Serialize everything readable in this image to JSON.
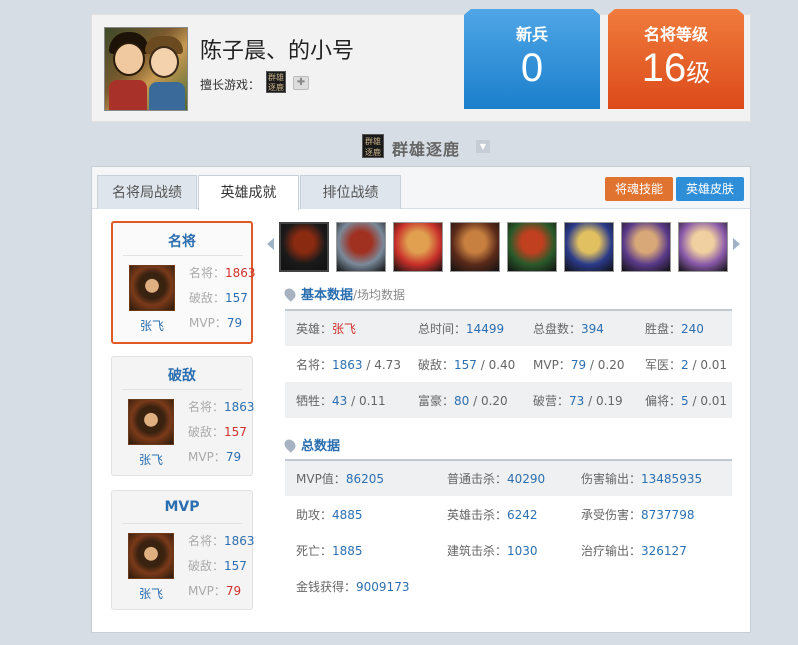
{
  "header": {
    "username": "陈子晨、的小号",
    "game_label": "擅长游戏：",
    "game_icon_text": "群雄逐鹿",
    "badges": [
      {
        "title": "新兵",
        "value": "0",
        "unit": "",
        "color": "#2b8ad9"
      },
      {
        "title": "名将等级",
        "value": "16",
        "unit": "级",
        "color": "#e35a22"
      }
    ]
  },
  "game_selector": {
    "icon_text": "群雄逐鹿",
    "name": "群雄逐鹿"
  },
  "tabs": [
    {
      "label": "名将局战绩",
      "active": false
    },
    {
      "label": "英雄成就",
      "active": true
    },
    {
      "label": "排位战绩",
      "active": false
    }
  ],
  "buttons": {
    "skill": "将魂技能",
    "skin": "英雄皮肤"
  },
  "cards": [
    {
      "title": "名将",
      "hero": "张飞",
      "stats": [
        {
          "label": "名将：",
          "value": "1863",
          "red": true
        },
        {
          "label": "破敌：",
          "value": "157",
          "red": false
        },
        {
          "label": "MVP：",
          "value": "79",
          "red": false
        }
      ]
    },
    {
      "title": "破敌",
      "hero": "张飞",
      "stats": [
        {
          "label": "名将：",
          "value": "1863",
          "red": false
        },
        {
          "label": "破敌：",
          "value": "157",
          "red": true
        },
        {
          "label": "MVP：",
          "value": "79",
          "red": false
        }
      ]
    },
    {
      "title": "MVP",
      "hero": "张飞",
      "stats": [
        {
          "label": "名将：",
          "value": "1863",
          "red": false
        },
        {
          "label": "破敌：",
          "value": "157",
          "red": false
        },
        {
          "label": "MVP：",
          "value": "79",
          "red": true
        }
      ]
    }
  ],
  "hero_strip": [
    {
      "name": "hero-portrait-1",
      "colors": [
        "#1a1a1a",
        "#8a2a10"
      ],
      "selected": true
    },
    {
      "name": "hero-portrait-2",
      "colors": [
        "#7a8a9a",
        "#a03020"
      ],
      "selected": false
    },
    {
      "name": "hero-portrait-3",
      "colors": [
        "#c8302a",
        "#e0a050"
      ],
      "selected": false
    },
    {
      "name": "hero-portrait-4",
      "colors": [
        "#5a2a1a",
        "#c88040"
      ],
      "selected": false
    },
    {
      "name": "hero-portrait-5",
      "colors": [
        "#2a5a2a",
        "#c04020"
      ],
      "selected": false
    },
    {
      "name": "hero-portrait-6",
      "colors": [
        "#2a3a8a",
        "#e0c060"
      ],
      "selected": false
    },
    {
      "name": "hero-portrait-7",
      "colors": [
        "#5a3a8a",
        "#d8a878"
      ],
      "selected": false
    },
    {
      "name": "hero-portrait-8",
      "colors": [
        "#8a5aaa",
        "#f0d0a0"
      ],
      "selected": false
    }
  ],
  "basic": {
    "title": "基本数据",
    "subtitle": "/场均数据",
    "rows": [
      [
        {
          "label": "英雄：",
          "value": "张飞",
          "red": true,
          "rest": ""
        },
        {
          "label": "总时间：",
          "value": "14499",
          "rest": ""
        },
        {
          "label": "总盘数：",
          "value": "394",
          "rest": ""
        },
        {
          "label": "胜盘：",
          "value": "240",
          "rest": ""
        }
      ],
      [
        {
          "label": "名将：",
          "value": "1863",
          "rest": " / 4.73"
        },
        {
          "label": "破敌：",
          "value": "157",
          "rest": " / 0.40"
        },
        {
          "label": "MVP：",
          "value": "79",
          "rest": " / 0.20"
        },
        {
          "label": "军医：",
          "value": "2",
          "rest": " / 0.01"
        }
      ],
      [
        {
          "label": "牺牲：",
          "value": "43",
          "rest": " / 0.11"
        },
        {
          "label": "富豪：",
          "value": "80",
          "rest": " / 0.20"
        },
        {
          "label": "破营：",
          "value": "73",
          "rest": " / 0.19"
        },
        {
          "label": "偏将：",
          "value": "5",
          "rest": " / 0.01"
        }
      ]
    ]
  },
  "totals": {
    "title": "总数据",
    "rows": [
      [
        {
          "label": "MVP值：",
          "value": "86205"
        },
        {
          "label": "普通击杀：",
          "value": "40290"
        },
        {
          "label": "伤害输出：",
          "value": "13485935"
        }
      ],
      [
        {
          "label": "助攻：",
          "value": "4885"
        },
        {
          "label": "英雄击杀：",
          "value": "6242"
        },
        {
          "label": "承受伤害：",
          "value": "8737798"
        }
      ],
      [
        {
          "label": "死亡：",
          "value": "1885"
        },
        {
          "label": "建筑击杀：",
          "value": "1030"
        },
        {
          "label": "治疗输出：",
          "value": "326127"
        }
      ],
      [
        {
          "label": "金钱获得：",
          "value": "9009173"
        }
      ]
    ]
  }
}
